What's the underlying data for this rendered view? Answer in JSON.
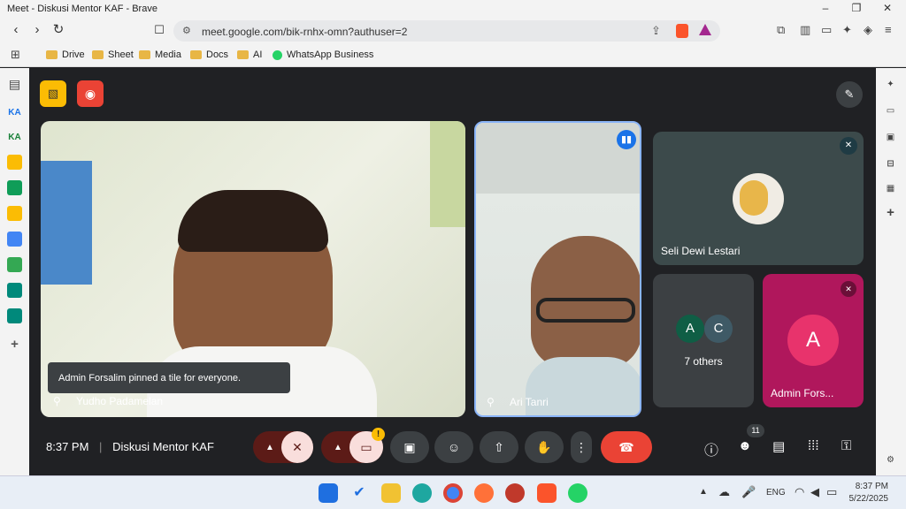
{
  "window": {
    "title": "Meet - Diskusi Mentor KAF - Brave"
  },
  "browser": {
    "url": "meet.google.com/bik-rnhx-omn?authuser=2",
    "bookmarks": [
      "Drive",
      "Sheet",
      "Media",
      "Docs",
      "AI",
      "WhatsApp Business"
    ]
  },
  "sidebar_left": [
    "KA",
    "KA"
  ],
  "meeting": {
    "time": "8:37 PM",
    "title": "Diskusi Mentor KAF",
    "pinned_toast": "Admin Forsalim pinned a tile for everyone.",
    "participants": [
      {
        "name": "Yudho Padamelan"
      },
      {
        "name": "Ari Tanri"
      },
      {
        "name": "Seli Dewi Lestari"
      },
      {
        "name": "7 others",
        "initials": [
          "A",
          "C"
        ]
      },
      {
        "name": "Admin Fors...",
        "initial": "A"
      }
    ],
    "people_count": "11",
    "warning_badge": "!"
  },
  "taskbar": {
    "lang": "ENG",
    "time": "8:37 PM",
    "date": "5/22/2025"
  },
  "colors": {
    "meet_bg": "#202124",
    "end_call": "#ea4335",
    "mic_off": "#f9dedc",
    "admin_tile": "#b0175c",
    "badge_blue": "#1a73e8"
  }
}
